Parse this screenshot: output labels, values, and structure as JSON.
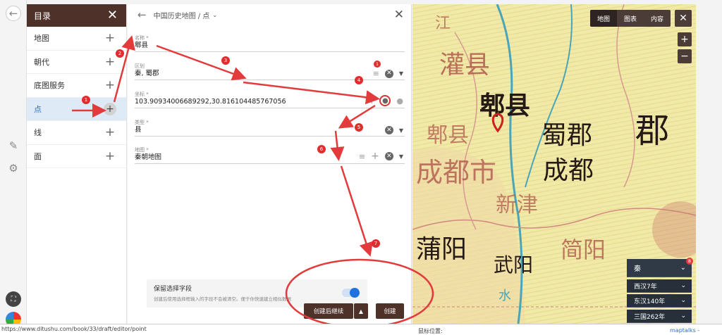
{
  "toc": {
    "title": "目录",
    "items": [
      {
        "label": "地图"
      },
      {
        "label": "朝代"
      },
      {
        "label": "底图服务"
      },
      {
        "label": "点"
      },
      {
        "label": "线"
      },
      {
        "label": "面"
      }
    ]
  },
  "form": {
    "breadcrumb": "中国历史地图 / 点",
    "fields": [
      {
        "label": "名称 *",
        "value": "郫县"
      },
      {
        "label": "区划",
        "value": "秦, 蜀郡"
      },
      {
        "label": "坐标 *",
        "value": "103.90934006689292,30.816104485767056"
      },
      {
        "label": "类型 *",
        "value": "县"
      },
      {
        "label": "地图 *",
        "value": "秦朝地图"
      }
    ],
    "keep": {
      "title": "保留选择字段",
      "desc": "创建后使用选择框输入的字段不会被清空。便于你快速建立相似数据"
    },
    "create_continue": "创建后继续",
    "create": "创建"
  },
  "map": {
    "tabs": [
      "地图",
      "图表",
      "内容"
    ],
    "zoom_in": "+",
    "zoom_out": "−",
    "close": "✕",
    "labels": [
      "灌县",
      "江",
      "郫县",
      "蜀郡",
      "郫县",
      "成都市",
      "成都",
      "郡",
      "新津",
      "蒲阳",
      "武阳",
      "简阳",
      "水"
    ],
    "eras": [
      "秦",
      "西汉7年",
      "东汉140年",
      "三国262年"
    ],
    "era_badge": "8"
  },
  "annotations": [
    "1",
    "2",
    "3",
    "4",
    "5",
    "6",
    "7",
    "1"
  ],
  "status": {
    "url": "https://www.ditushu.com/book/33/draft/editor/point",
    "mouse": "鼠标位置:",
    "attribution": "maptalks -"
  }
}
